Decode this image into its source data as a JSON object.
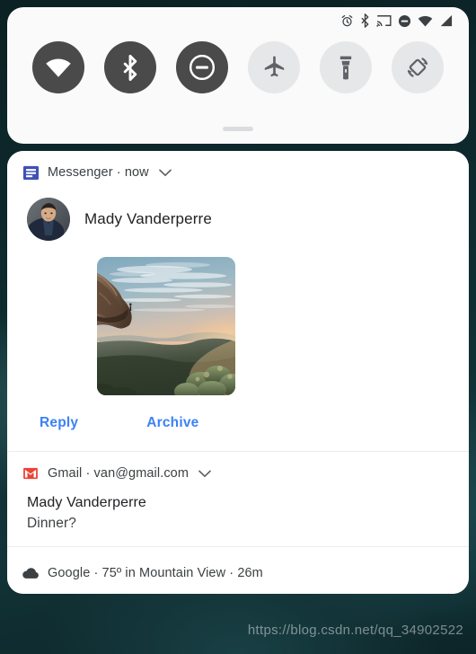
{
  "status_bar": {
    "icons": [
      {
        "name": "alarm-icon",
        "label": "alarm"
      },
      {
        "name": "bluetooth-icon",
        "label": "bluetooth"
      },
      {
        "name": "cast-icon",
        "label": "cast"
      },
      {
        "name": "do-not-disturb-icon",
        "label": "do not disturb"
      },
      {
        "name": "wifi-icon",
        "label": "wifi"
      },
      {
        "name": "cell-signal-icon",
        "label": "cell signal"
      }
    ]
  },
  "quick_settings": {
    "tiles": [
      {
        "name": "wifi-tile",
        "label": "Wi-Fi",
        "state": "on"
      },
      {
        "name": "bluetooth-tile",
        "label": "Bluetooth",
        "state": "on"
      },
      {
        "name": "dnd-tile",
        "label": "Do Not Disturb",
        "state": "on"
      },
      {
        "name": "airplane-tile",
        "label": "Airplane mode",
        "state": "off"
      },
      {
        "name": "flashlight-tile",
        "label": "Flashlight",
        "state": "off"
      },
      {
        "name": "auto-rotate-tile",
        "label": "Auto-rotate",
        "state": "off"
      }
    ],
    "handle_label": "Expand quick settings"
  },
  "notifications": [
    {
      "app": "Messenger",
      "header": "Messenger · now",
      "sender": "Mady Vanderperre",
      "actions": [
        "Reply",
        "Archive"
      ],
      "image_alt": "Sunset over a valley from a rocky cliff"
    },
    {
      "app": "Gmail",
      "header": "Gmail · van@gmail.com",
      "title": "Mady Vanderperre",
      "text": "Dinner?"
    },
    {
      "app": "Google",
      "header": "Google · 75º in Mountain View · 26m"
    }
  ],
  "colors": {
    "action_blue": "#3b82f6",
    "tile_on_bg": "#4a4a4a",
    "tile_off_bg": "#e6e7e8",
    "gmail_red": "#ea4335",
    "messenger_blue": "#3f51b5"
  },
  "watermark": "https://blog.csdn.net/qq_34902522"
}
